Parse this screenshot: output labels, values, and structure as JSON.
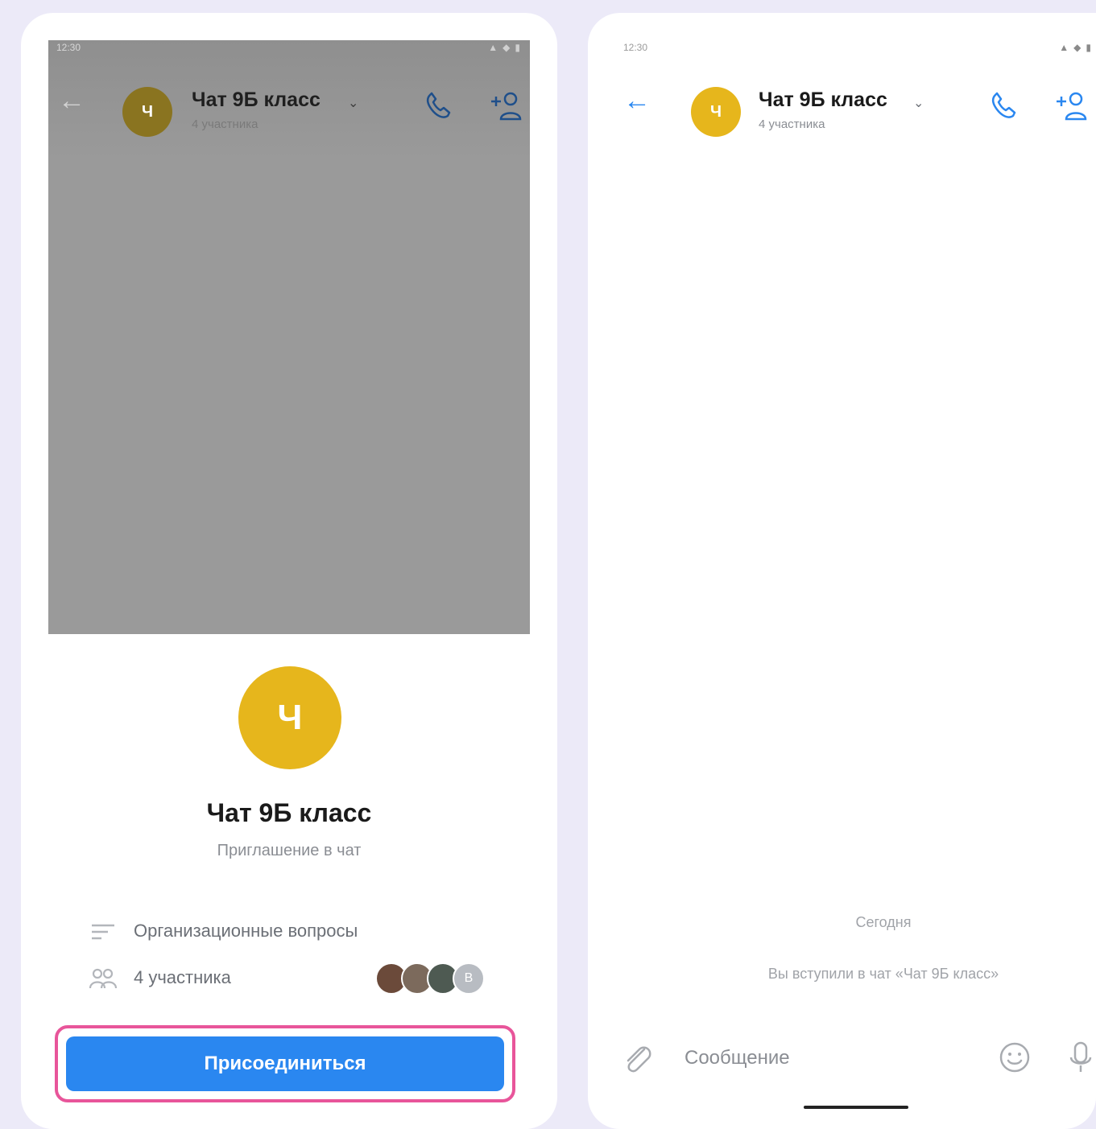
{
  "colors": {
    "accent": "#2a87f0",
    "avatar_yellow": "#e6b61c",
    "highlight_pink": "#e8559a",
    "dim_overlay": "#9a9a9a"
  },
  "left_phone": {
    "header": {
      "back_icon": "arrow-left-icon",
      "avatar_letter": "Ч",
      "title": "Чат 9Б класс",
      "subtitle": "4 участника",
      "call_icon": "phone-icon",
      "add_icon": "add-user-icon"
    },
    "invite_sheet": {
      "avatar_letter": "Ч",
      "title": "Чат 9Б класс",
      "subtitle": "Приглашение в чат",
      "description": "Организационные вопросы",
      "members_label": "4 участника",
      "member_avatars": [
        "photo",
        "photo",
        "photo",
        "В"
      ],
      "join_label": "Присоединиться"
    }
  },
  "right_phone": {
    "header": {
      "back_icon": "arrow-left-icon",
      "avatar_letter": "Ч",
      "title": "Чат 9Б класс",
      "subtitle": "4 участника",
      "call_icon": "phone-icon",
      "add_icon": "add-user-icon"
    },
    "date_label": "Сегодня",
    "system_message": "Вы вступили в чат «Чат 9Б класс»",
    "composer": {
      "placeholder": "Сообщение",
      "attach_icon": "paperclip-icon",
      "emoji_icon": "smile-icon",
      "mic_icon": "microphone-icon"
    }
  }
}
